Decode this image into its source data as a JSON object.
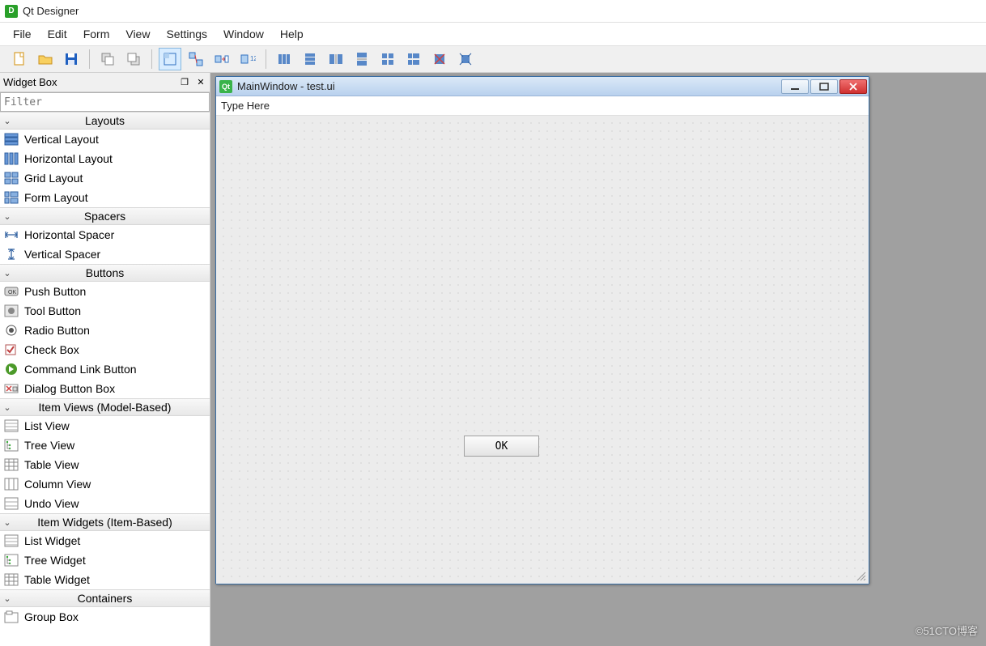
{
  "app": {
    "title": "Qt Designer",
    "icon_letter": "D"
  },
  "menu": [
    "File",
    "Edit",
    "Form",
    "View",
    "Settings",
    "Window",
    "Help"
  ],
  "dock": {
    "title": "Widget Box",
    "filter_placeholder": "Filter",
    "categories": [
      {
        "name": "Layouts",
        "items": [
          {
            "label": "Vertical Layout",
            "icon": "vlayout"
          },
          {
            "label": "Horizontal Layout",
            "icon": "hlayout"
          },
          {
            "label": "Grid Layout",
            "icon": "grid"
          },
          {
            "label": "Form Layout",
            "icon": "form"
          }
        ]
      },
      {
        "name": "Spacers",
        "items": [
          {
            "label": "Horizontal Spacer",
            "icon": "hspacer"
          },
          {
            "label": "Vertical Spacer",
            "icon": "vspacer"
          }
        ]
      },
      {
        "name": "Buttons",
        "items": [
          {
            "label": "Push Button",
            "icon": "pushbtn"
          },
          {
            "label": "Tool Button",
            "icon": "toolbtn"
          },
          {
            "label": "Radio Button",
            "icon": "radio"
          },
          {
            "label": "Check Box",
            "icon": "check"
          },
          {
            "label": "Command Link Button",
            "icon": "cmdlink"
          },
          {
            "label": "Dialog Button Box",
            "icon": "dlgbox"
          }
        ]
      },
      {
        "name": "Item Views (Model-Based)",
        "items": [
          {
            "label": "List View",
            "icon": "listv"
          },
          {
            "label": "Tree View",
            "icon": "treev"
          },
          {
            "label": "Table View",
            "icon": "tablev"
          },
          {
            "label": "Column View",
            "icon": "colv"
          },
          {
            "label": "Undo View",
            "icon": "undov"
          }
        ]
      },
      {
        "name": "Item Widgets (Item-Based)",
        "items": [
          {
            "label": "List Widget",
            "icon": "listv"
          },
          {
            "label": "Tree Widget",
            "icon": "treev"
          },
          {
            "label": "Table Widget",
            "icon": "tablev"
          }
        ]
      },
      {
        "name": "Containers",
        "items": [
          {
            "label": "Group Box",
            "icon": "groupbox"
          }
        ]
      }
    ]
  },
  "designer_window": {
    "title": "MainWindow - test.ui",
    "icon_letter": "Qt",
    "menubar_placeholder": "Type Here",
    "button_label": "OK"
  },
  "watermark": "©51CTO博客"
}
